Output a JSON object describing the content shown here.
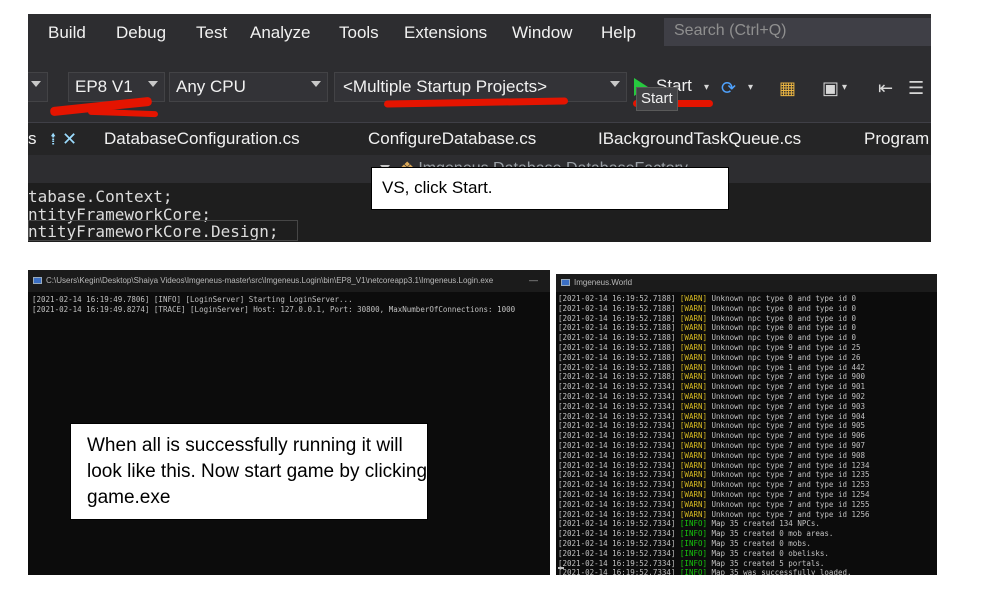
{
  "vs": {
    "menu": [
      "Build",
      "Debug",
      "Test",
      "Analyze",
      "Tools",
      "Extensions",
      "Window",
      "Help"
    ],
    "search_placeholder": "Search (Ctrl+Q)",
    "config_dropdown": "EP8 V1",
    "platform_dropdown": "Any CPU",
    "startup_dropdown": "<Multiple Startup Projects>",
    "start_label": "Start",
    "tooltip": "Start",
    "tabs": [
      "DatabaseConfiguration.cs",
      "ConfigureDatabase.cs",
      "IBackgroundTaskQueue.cs",
      "Program"
    ],
    "tab_pin_close": "⭫ ✕",
    "tab_prefix": "s",
    "nav_class": "Imgeneus.Database.DatabaseFactory",
    "code_lines": [
      "tabase.Context;",
      "ntityFrameworkCore;",
      "ntityFrameworkCore.Design;"
    ],
    "callout": "VS, click Start.",
    "accent_colors": {
      "play": "#27c93f",
      "scribble": "#e51400"
    }
  },
  "login_console": {
    "title": "C:\\Users\\Kegin\\Desktop\\Shaiya Videos\\Imgeneus-master\\src\\Imgeneus.Login\\bin\\EP8_V1\\netcoreapp3.1\\Imgeneus.Login.exe",
    "lines": [
      "[2021-02-14 16:19:49.7806] [INFO] [LoginServer] Starting LoginServer...",
      "[2021-02-14 16:19:49.8274] [TRACE] [LoginServer] Host: 127.0.0.1, Port: 30800, MaxNumberOfConnections: 1000"
    ]
  },
  "world_console": {
    "title": "Imgeneus.World",
    "lines": [
      {
        "ts": "[2021-02-14 16:19:52.7188]",
        "lvl": "[WARN]",
        "msg": "Unknown npc type 0 and type id 0"
      },
      {
        "ts": "[2021-02-14 16:19:52.7188]",
        "lvl": "[WARN]",
        "msg": "Unknown npc type 0 and type id 0"
      },
      {
        "ts": "[2021-02-14 16:19:52.7188]",
        "lvl": "[WARN]",
        "msg": "Unknown npc type 0 and type id 0"
      },
      {
        "ts": "[2021-02-14 16:19:52.7188]",
        "lvl": "[WARN]",
        "msg": "Unknown npc type 0 and type id 0"
      },
      {
        "ts": "[2021-02-14 16:19:52.7188]",
        "lvl": "[WARN]",
        "msg": "Unknown npc type 0 and type id 0"
      },
      {
        "ts": "[2021-02-14 16:19:52.7188]",
        "lvl": "[WARN]",
        "msg": "Unknown npc type 9 and type id 25"
      },
      {
        "ts": "[2021-02-14 16:19:52.7188]",
        "lvl": "[WARN]",
        "msg": "Unknown npc type 9 and type id 26"
      },
      {
        "ts": "[2021-02-14 16:19:52.7188]",
        "lvl": "[WARN]",
        "msg": "Unknown npc type 1 and type id 442"
      },
      {
        "ts": "[2021-02-14 16:19:52.7188]",
        "lvl": "[WARN]",
        "msg": "Unknown npc type 7 and type id 900"
      },
      {
        "ts": "[2021-02-14 16:19:52.7334]",
        "lvl": "[WARN]",
        "msg": "Unknown npc type 7 and type id 901"
      },
      {
        "ts": "[2021-02-14 16:19:52.7334]",
        "lvl": "[WARN]",
        "msg": "Unknown npc type 7 and type id 902"
      },
      {
        "ts": "[2021-02-14 16:19:52.7334]",
        "lvl": "[WARN]",
        "msg": "Unknown npc type 7 and type id 903"
      },
      {
        "ts": "[2021-02-14 16:19:52.7334]",
        "lvl": "[WARN]",
        "msg": "Unknown npc type 7 and type id 904"
      },
      {
        "ts": "[2021-02-14 16:19:52.7334]",
        "lvl": "[WARN]",
        "msg": "Unknown npc type 7 and type id 905"
      },
      {
        "ts": "[2021-02-14 16:19:52.7334]",
        "lvl": "[WARN]",
        "msg": "Unknown npc type 7 and type id 906"
      },
      {
        "ts": "[2021-02-14 16:19:52.7334]",
        "lvl": "[WARN]",
        "msg": "Unknown npc type 7 and type id 907"
      },
      {
        "ts": "[2021-02-14 16:19:52.7334]",
        "lvl": "[WARN]",
        "msg": "Unknown npc type 7 and type id 908"
      },
      {
        "ts": "[2021-02-14 16:19:52.7334]",
        "lvl": "[WARN]",
        "msg": "Unknown npc type 7 and type id 1234"
      },
      {
        "ts": "[2021-02-14 16:19:52.7334]",
        "lvl": "[WARN]",
        "msg": "Unknown npc type 7 and type id 1235"
      },
      {
        "ts": "[2021-02-14 16:19:52.7334]",
        "lvl": "[WARN]",
        "msg": "Unknown npc type 7 and type id 1253"
      },
      {
        "ts": "[2021-02-14 16:19:52.7334]",
        "lvl": "[WARN]",
        "msg": "Unknown npc type 7 and type id 1254"
      },
      {
        "ts": "[2021-02-14 16:19:52.7334]",
        "lvl": "[WARN]",
        "msg": "Unknown npc type 7 and type id 1255"
      },
      {
        "ts": "[2021-02-14 16:19:52.7334]",
        "lvl": "[WARN]",
        "msg": "Unknown npc type 7 and type id 1256"
      },
      {
        "ts": "[2021-02-14 16:19:52.7334]",
        "lvl": "[INFO]",
        "msg": "Map 35 created 134 NPCs."
      },
      {
        "ts": "[2021-02-14 16:19:52.7334]",
        "lvl": "[INFO]",
        "msg": "Map 35 created 0 mob areas."
      },
      {
        "ts": "[2021-02-14 16:19:52.7334]",
        "lvl": "[INFO]",
        "msg": "Map 35 created 0 mobs."
      },
      {
        "ts": "[2021-02-14 16:19:52.7334]",
        "lvl": "[INFO]",
        "msg": "Map 35 created 0 obelisks."
      },
      {
        "ts": "[2021-02-14 16:19:52.7334]",
        "lvl": "[INFO]",
        "msg": "Map 35 created 5 portals."
      },
      {
        "ts": "[2021-02-14 16:19:52.7334]",
        "lvl": "[INFO]",
        "msg": "Map 35 was successfully loaded."
      }
    ]
  },
  "callout_run": "When all is successfully running it will look like this. Now start game by clicking game.exe"
}
